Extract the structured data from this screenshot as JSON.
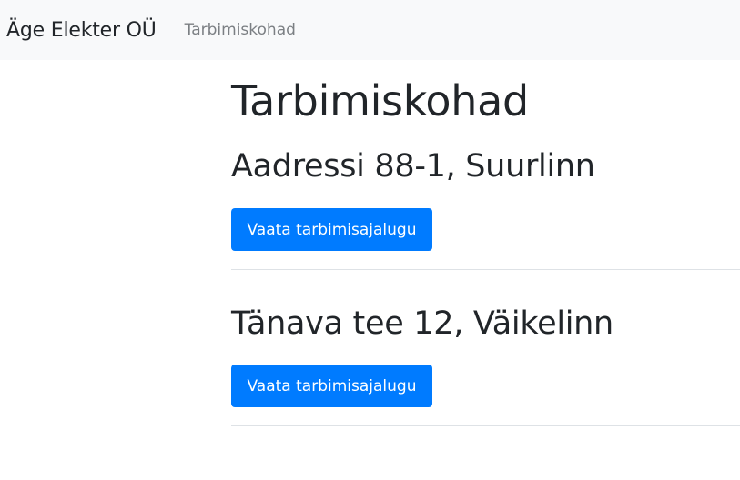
{
  "navbar": {
    "brand": "Äge Elekter OÜ",
    "link": "Tarbimiskohad"
  },
  "main": {
    "title": "Tarbimiskohad",
    "places": [
      {
        "address": "Aadressi 88-1, Suurlinn",
        "button_label": "Vaata tarbimisajalugu"
      },
      {
        "address": "Tänava tee 12, Väikelinn",
        "button_label": "Vaata tarbimisajalugu"
      }
    ]
  },
  "colors": {
    "navbar_bg": "#f8f9fa",
    "primary": "#007bff",
    "text": "#212529",
    "muted": "#7b7f83",
    "divider": "#dee2e6"
  }
}
